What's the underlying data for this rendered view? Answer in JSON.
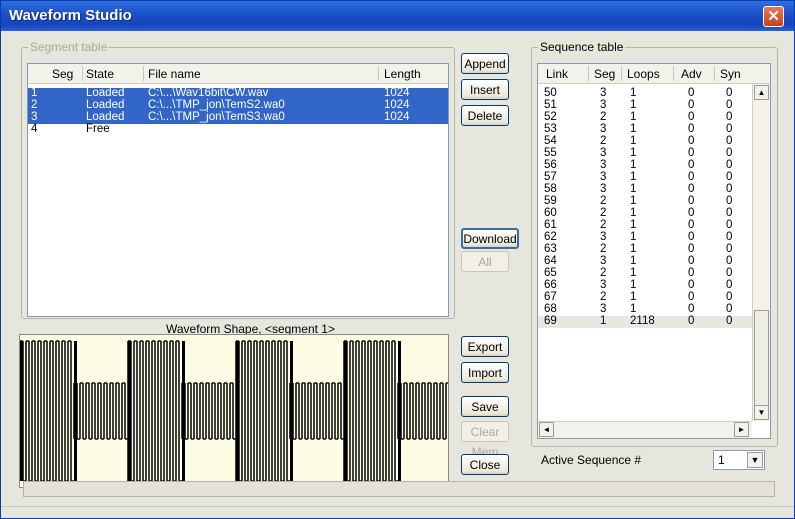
{
  "window": {
    "title": "Waveform Studio",
    "close_glyph": "✕"
  },
  "segment_table": {
    "label": "Segment table",
    "columns": [
      "Seg",
      "State",
      "File name",
      "Length"
    ],
    "rows": [
      {
        "seg": "1",
        "state": "Loaded",
        "file": "C:\\...\\Wav16bit\\CW.wav",
        "length": "1024",
        "selected": true
      },
      {
        "seg": "2",
        "state": "Loaded",
        "file": "C:\\...\\TMP_jon\\TemS2.wa0",
        "length": "1024",
        "selected": true
      },
      {
        "seg": "3",
        "state": "Loaded",
        "file": "C:\\...\\TMP_jon\\TemS3.wa0",
        "length": "1024",
        "selected": true
      },
      {
        "seg": "4",
        "state": "Free",
        "file": "",
        "length": "",
        "selected": false
      }
    ]
  },
  "buttons": {
    "append": "Append",
    "insert": "Insert",
    "delete": "Delete",
    "download": "Download",
    "all": "All",
    "export": "Export",
    "import": "Import",
    "save": "Save",
    "clear_mem": "Clear Mem",
    "close": "Close"
  },
  "waveform": {
    "title": "Waveform Shape, <segment 1>"
  },
  "sequence_table": {
    "label": "Sequence table",
    "columns": [
      "Link",
      "Seg",
      "Loops",
      "Adv",
      "Syn"
    ],
    "rows": [
      [
        "50",
        "3",
        "1",
        "0",
        "0"
      ],
      [
        "51",
        "3",
        "1",
        "0",
        "0"
      ],
      [
        "52",
        "2",
        "1",
        "0",
        "0"
      ],
      [
        "53",
        "3",
        "1",
        "0",
        "0"
      ],
      [
        "54",
        "2",
        "1",
        "0",
        "0"
      ],
      [
        "55",
        "3",
        "1",
        "0",
        "0"
      ],
      [
        "56",
        "3",
        "1",
        "0",
        "0"
      ],
      [
        "57",
        "3",
        "1",
        "0",
        "0"
      ],
      [
        "58",
        "3",
        "1",
        "0",
        "0"
      ],
      [
        "59",
        "2",
        "1",
        "0",
        "0"
      ],
      [
        "60",
        "2",
        "1",
        "0",
        "0"
      ],
      [
        "61",
        "2",
        "1",
        "0",
        "0"
      ],
      [
        "62",
        "3",
        "1",
        "0",
        "0"
      ],
      [
        "63",
        "2",
        "1",
        "0",
        "0"
      ],
      [
        "64",
        "3",
        "1",
        "0",
        "0"
      ],
      [
        "65",
        "2",
        "1",
        "0",
        "0"
      ],
      [
        "66",
        "3",
        "1",
        "0",
        "0"
      ],
      [
        "67",
        "2",
        "1",
        "0",
        "0"
      ],
      [
        "68",
        "3",
        "1",
        "0",
        "0"
      ],
      [
        "69",
        "1",
        "2118",
        "0",
        "0"
      ]
    ]
  },
  "active_sequence": {
    "label": "Active Sequence #",
    "value": "1"
  },
  "icons": {
    "up": "▲",
    "down": "▼",
    "left": "◄",
    "right": "►"
  }
}
